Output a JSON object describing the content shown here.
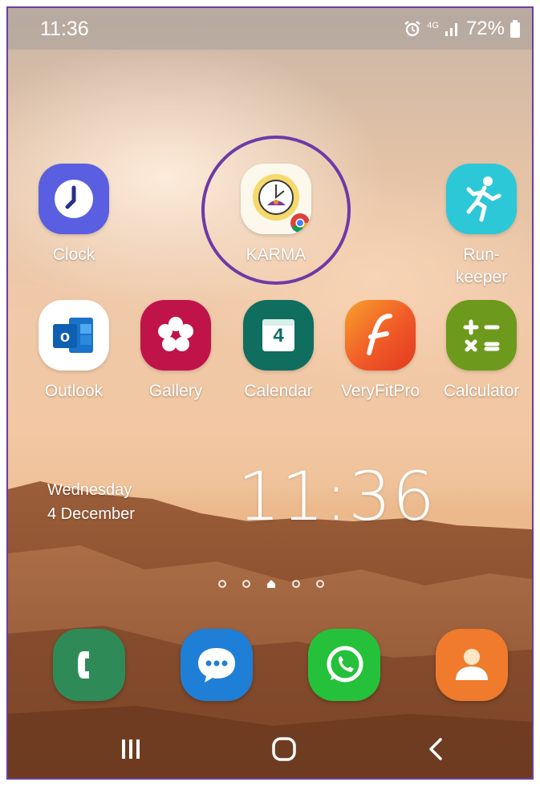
{
  "status_bar": {
    "time": "11:36",
    "network": "4G",
    "battery_percent": "72%",
    "icons": [
      "alarm-icon",
      "network-4g-icon",
      "signal-icon",
      "battery-icon"
    ]
  },
  "apps_row1": [
    {
      "label": "Clock",
      "icon": "clock-icon"
    },
    {
      "label": "KARMA",
      "icon": "karma-icon"
    },
    {
      "label_line1": "Run-",
      "label_line2": "keeper",
      "icon": "runner-icon"
    }
  ],
  "apps_row2": [
    {
      "label": "Outlook",
      "icon": "outlook-icon"
    },
    {
      "label": "Gallery",
      "icon": "flower-icon"
    },
    {
      "label": "Calendar",
      "icon": "calendar-icon",
      "day": "4"
    },
    {
      "label": "VeryFitPro",
      "icon": "veryfit-icon"
    },
    {
      "label": "Calculator",
      "icon": "calculator-icon"
    }
  ],
  "clock_widget": {
    "weekday": "Wednesday",
    "date": "4 December",
    "time": "11:36"
  },
  "page_indicator": {
    "pages": 5,
    "current_is_home": true
  },
  "dock": [
    {
      "name": "phone",
      "icon": "phone-icon",
      "color": "#2e8b57"
    },
    {
      "name": "messages",
      "icon": "message-icon",
      "color": "#1f7fd6"
    },
    {
      "name": "whatsapp",
      "icon": "whatsapp-icon",
      "color": "#25c13a"
    },
    {
      "name": "contacts",
      "icon": "contact-icon",
      "color": "#f07b2c"
    }
  ],
  "navigation": [
    "recents-icon",
    "home-icon",
    "back-icon"
  ],
  "colors": {
    "highlight_ring": "#6d3aa6",
    "clock_tile": "#5a5ee0",
    "runkeeper_tile": "#2cc8d8",
    "gallery_tile": "#c0134a",
    "calendar_tile": "#0f6e5e",
    "veryfit_tile": "#f05a28",
    "calculator_tile": "#6d9a1c"
  }
}
